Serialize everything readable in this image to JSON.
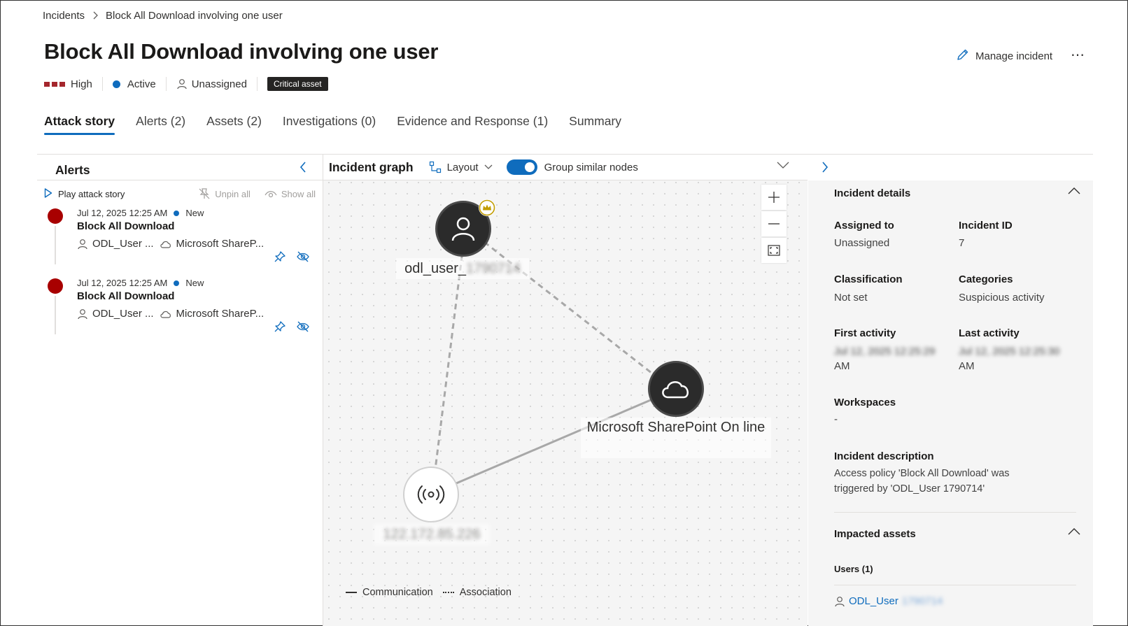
{
  "breadcrumb": {
    "parent": "Incidents",
    "current": "Block All Download involving one user"
  },
  "header": {
    "title": "Block All Download involving one user",
    "manage_label": "Manage incident",
    "more_label": "⋯",
    "severity": "High",
    "status": "Active",
    "assignee": "Unassigned",
    "badge": "Critical asset"
  },
  "tabs": [
    {
      "label": "Attack story",
      "active": true
    },
    {
      "label": "Alerts (2)"
    },
    {
      "label": "Assets (2)"
    },
    {
      "label": "Investigations (0)"
    },
    {
      "label": "Evidence and Response (1)"
    },
    {
      "label": "Summary"
    }
  ],
  "alerts_panel": {
    "title": "Alerts",
    "play_label": "Play attack story",
    "unpin_label": "Unpin all",
    "show_label": "Show all",
    "items": [
      {
        "time": "Jul 12, 2025 12:25 AM",
        "status": "New",
        "name": "Block All Download",
        "user": "ODL_User ...",
        "app": "Microsoft ShareP..."
      },
      {
        "time": "Jul 12, 2025 12:25 AM",
        "status": "New",
        "name": "Block All Download",
        "user": "ODL_User ...",
        "app": "Microsoft ShareP..."
      }
    ]
  },
  "graph": {
    "title": "Incident graph",
    "layout_label": "Layout",
    "group_label": "Group similar nodes",
    "group_enabled": true,
    "nodes": {
      "user_label": "odl_user_",
      "user_label_hidden": "1790714",
      "app_label": "Microsoft SharePoint On line",
      "ip_label": "122.172.85.226"
    },
    "legend": {
      "communication": "Communication",
      "association": "Association"
    }
  },
  "details": {
    "section_title": "Incident details",
    "assigned_label": "Assigned to",
    "assigned_value": "Unassigned",
    "id_label": "Incident ID",
    "id_value": "7",
    "classification_label": "Classification",
    "classification_value": "Not set",
    "categories_label": "Categories",
    "categories_value": "Suspicious activity",
    "first_label": "First activity",
    "first_value_hidden": "Jul 12, 2025 12:25:29",
    "first_value_suffix": "AM",
    "last_label": "Last activity",
    "last_value_hidden": "Jul 12, 2025 12:25:30",
    "last_value_suffix": "AM",
    "workspaces_label": "Workspaces",
    "workspaces_value": "-",
    "description_label": "Incident description",
    "description_line1": "Access policy 'Block All Download' was",
    "description_line2": "triggered by 'ODL_User 1790714'"
  },
  "impacted": {
    "section_title": "Impacted assets",
    "users_label": "Users (1)",
    "user_link": "ODL_User",
    "user_link_hidden": "1790714"
  },
  "colors": {
    "accent": "#0f6cbd",
    "severity": "#a80000",
    "node_dark": "#2b2b2b",
    "crown": "#c19c00"
  }
}
